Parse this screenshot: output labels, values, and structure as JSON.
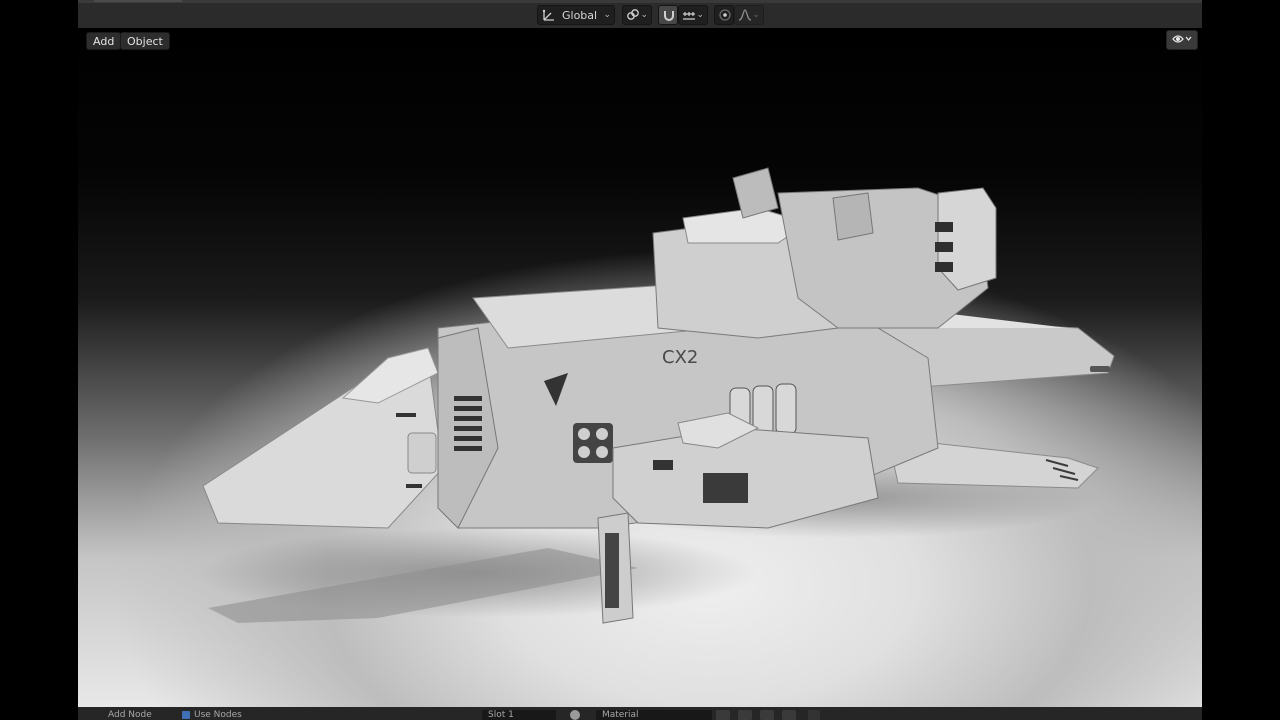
{
  "header": {
    "orientation": {
      "label": "Global",
      "icon": "transform-orientation-icon"
    },
    "pivot_icon": "pivot-link-icon",
    "snap_icon": "snap-magnet-icon",
    "snap_target_icon": "snap-increment-icon",
    "proportional_icon": "proportional-edit-icon",
    "falloff_icon": "falloff-curve-icon"
  },
  "viewport": {
    "menus": {
      "add": "Add",
      "object": "Object"
    },
    "visibility_icon": "eye-visibility-icon",
    "model_marking": "CX2"
  },
  "statusbar": {
    "items": [
      "Add Node",
      "Use Nodes"
    ],
    "slot_field": "Slot 1",
    "material_field": "Material"
  },
  "colors": {
    "header_bg": "#2b2b2b",
    "button_bg": "#1f1f1f",
    "text": "#d6d6d6",
    "model_light": "#dedede",
    "model_shadow": "#7a7a7a"
  }
}
